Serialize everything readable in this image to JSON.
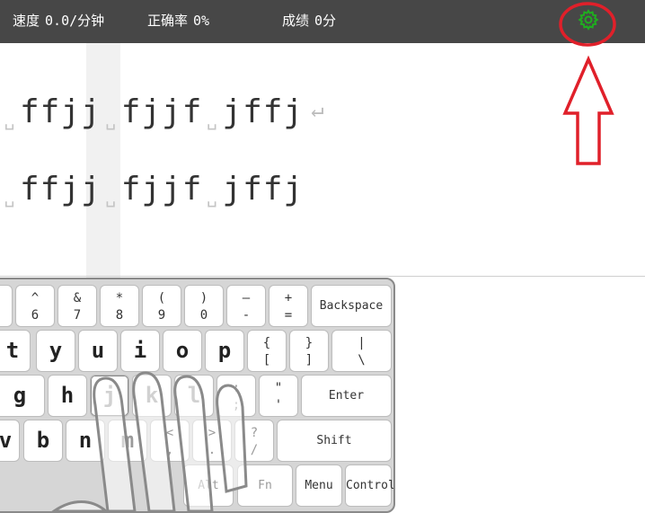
{
  "stats": {
    "speed_label": "速度",
    "speed_value": "0.0/分钟",
    "accuracy_label": "正确率",
    "accuracy_value": "0%",
    "score_label": "成绩",
    "score_value": "0分"
  },
  "settings": {
    "icon": "gear-icon",
    "color": "#1fae1f"
  },
  "annotation": {
    "color": "#e0202a"
  },
  "practice": {
    "line1": [
      "ffjj",
      "fjjf",
      "jffj"
    ],
    "line2": [
      "ffjj",
      "fjjf",
      "jffj"
    ],
    "space_symbol": "␣",
    "enter_symbol": "↵"
  },
  "keyboard": {
    "row1": [
      {
        "top": "^",
        "bot": "6"
      },
      {
        "top": "&",
        "bot": "7"
      },
      {
        "top": "*",
        "bot": "8"
      },
      {
        "top": "(",
        "bot": "9"
      },
      {
        "top": ")",
        "bot": "0"
      },
      {
        "top": "—",
        "bot": "-"
      },
      {
        "top": "+",
        "bot": "="
      }
    ],
    "backspace": "Backspace",
    "row2_letters": [
      "t",
      "y",
      "u",
      "i",
      "o",
      "p"
    ],
    "row2_symbols": [
      {
        "top": "{",
        "bot": "["
      },
      {
        "top": "}",
        "bot": "]"
      },
      {
        "top": "|",
        "bot": "\\"
      }
    ],
    "row3_letters": [
      "g",
      "h",
      "j",
      "k",
      "l"
    ],
    "row3_symbols": [
      {
        "top": ":",
        "bot": ";"
      },
      {
        "top": "\"",
        "bot": "'"
      }
    ],
    "enter": "Enter",
    "row4_letters": [
      "v",
      "b",
      "n",
      "m"
    ],
    "row4_symbols": [
      {
        "top": "<",
        "bot": ","
      },
      {
        "top": ">",
        "bot": "."
      },
      {
        "top": "?",
        "bot": "/"
      }
    ],
    "shift": "Shift",
    "alt": "Alt",
    "fn": "Fn",
    "menu": "Menu",
    "control": "Control"
  }
}
